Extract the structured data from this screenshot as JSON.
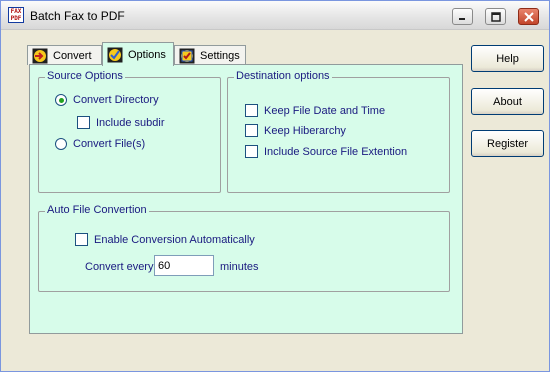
{
  "window": {
    "title": "Batch Fax to PDF",
    "app_icon_lines": [
      "FAX",
      "PDF"
    ],
    "controls": [
      "minimize",
      "maximize",
      "close"
    ]
  },
  "tabs": [
    {
      "label": "Convert",
      "icon": "arrow-right-icon",
      "active": false
    },
    {
      "label": "Options",
      "icon": "checkmark-icon",
      "active": true
    },
    {
      "label": "Settings",
      "icon": "settings-icon",
      "active": false
    }
  ],
  "source_options": {
    "title": "Source Options",
    "convert_directory": {
      "label": "Convert Directory",
      "selected": true
    },
    "include_subdir": {
      "label": "Include subdir",
      "checked": false
    },
    "convert_files": {
      "label": "Convert File(s)",
      "selected": false
    }
  },
  "destination_options": {
    "title": "Destination options",
    "keep_file_date": {
      "label": "Keep File Date and Time",
      "checked": false
    },
    "keep_hiberarchy": {
      "label": "Keep Hiberarchy",
      "checked": false
    },
    "include_extension": {
      "label": "Include Source File Extention",
      "checked": false
    }
  },
  "auto_conversion": {
    "title": "Auto File Convertion",
    "enable": {
      "label": "Enable Conversion Automatically",
      "checked": false
    },
    "convert_every_label": "Convert every",
    "interval_value": "60",
    "minutes_label": "minutes"
  },
  "side_buttons": {
    "help": "Help",
    "about": "About",
    "register": "Register"
  },
  "colors": {
    "panel_bg": "#d7fcea",
    "label_text": "#1a1a80",
    "window_bg": "#ece9d8",
    "radio_dot": "#21a121"
  }
}
